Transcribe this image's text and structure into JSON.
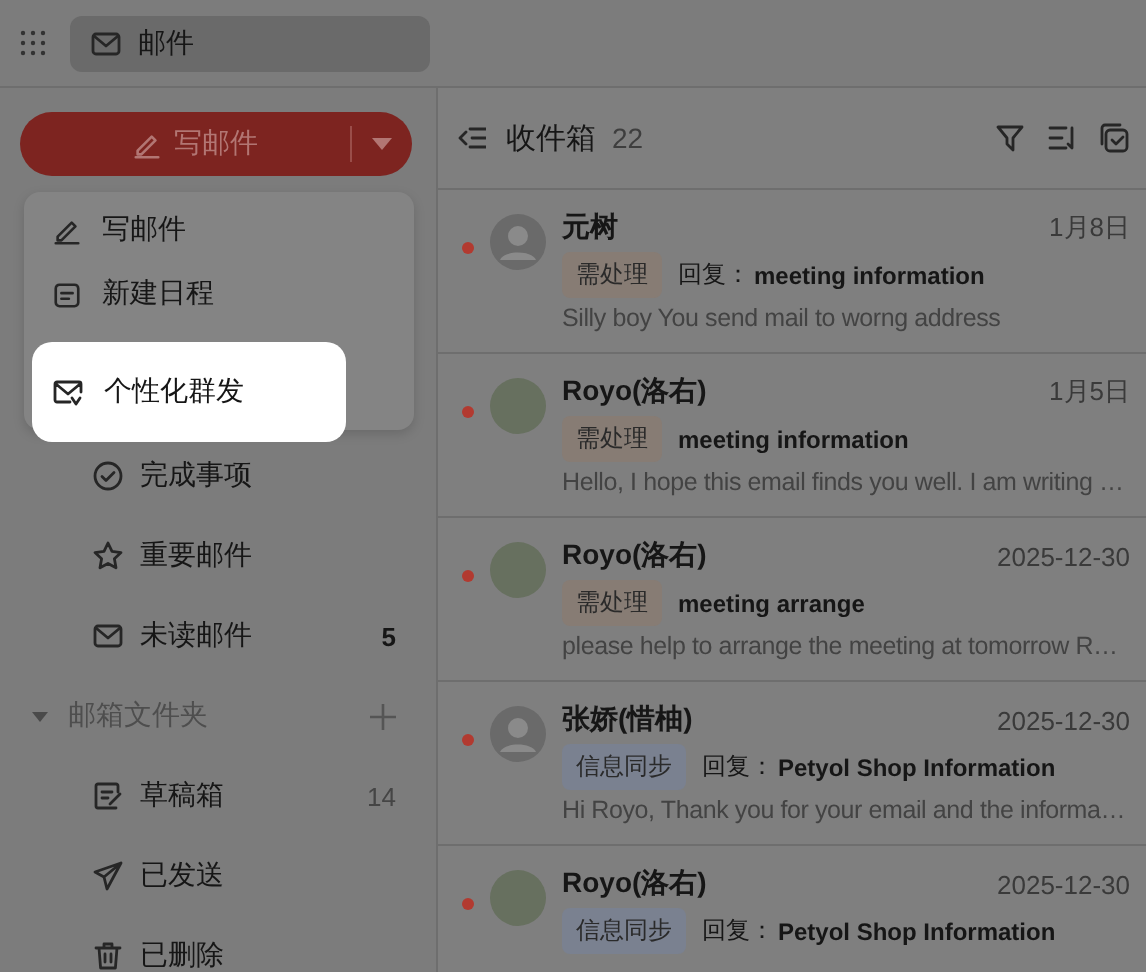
{
  "app_tabs": [
    {
      "label": "邮件",
      "selected": true
    }
  ],
  "compose_button": {
    "label": "写邮件"
  },
  "compose_menu": {
    "items": [
      {
        "label": "写邮件",
        "highlighted": false
      },
      {
        "label": "新建日程",
        "highlighted": false
      },
      {
        "label": "个性化群发",
        "highlighted": true
      }
    ]
  },
  "sidebar": {
    "items": [
      {
        "label": "完成事项"
      },
      {
        "label": "重要邮件"
      },
      {
        "label": "未读邮件",
        "count": "5"
      }
    ],
    "folders": {
      "label": "邮箱文件夹",
      "expanded": true,
      "children": [
        {
          "label": "草稿箱",
          "count": "14"
        },
        {
          "label": "已发送"
        },
        {
          "label": "已删除"
        }
      ]
    }
  },
  "inbox": {
    "title": "收件箱",
    "count": "22",
    "messages": [
      {
        "sender": "元树",
        "date": "1月8日",
        "unread": true,
        "kind": "default",
        "tag": {
          "label": "需处理",
          "color": "#877c74"
        },
        "prefix": "回复：",
        "subject": "meeting information",
        "preview": "Silly boy You send mail to worng address"
      },
      {
        "sender": "Royo(洛右)",
        "date": "1月5日",
        "unread": true,
        "kind": "photo",
        "tag": {
          "label": "需处理",
          "color": "#877c74"
        },
        "subject": "meeting information",
        "preview": "Hello, I hope this email finds you well. I am writing …"
      },
      {
        "sender": "Royo(洛右)",
        "date": "2025-12-30",
        "unread": true,
        "kind": "photo",
        "tag": {
          "label": "需处理",
          "color": "#877c74"
        },
        "subject": "meeting arrange",
        "preview": "please help to arrange the meeting at tomorrow R…"
      },
      {
        "sender": "张娇(惜柚)",
        "date": "2025-12-30",
        "unread": true,
        "kind": "default",
        "tag": {
          "label": "信息同步",
          "color": "#7a8190"
        },
        "prefix": "回复：",
        "subject": "Petyol Shop Information",
        "preview": "Hi Royo, Thank you for your email and the informa…"
      },
      {
        "sender": "Royo(洛右)",
        "date": "2025-12-30",
        "unread": true,
        "kind": "photo",
        "tag": {
          "label": "信息同步",
          "color": "#7a8190"
        },
        "prefix": "回复：",
        "subject": "Petyol Shop Information"
      }
    ]
  }
}
